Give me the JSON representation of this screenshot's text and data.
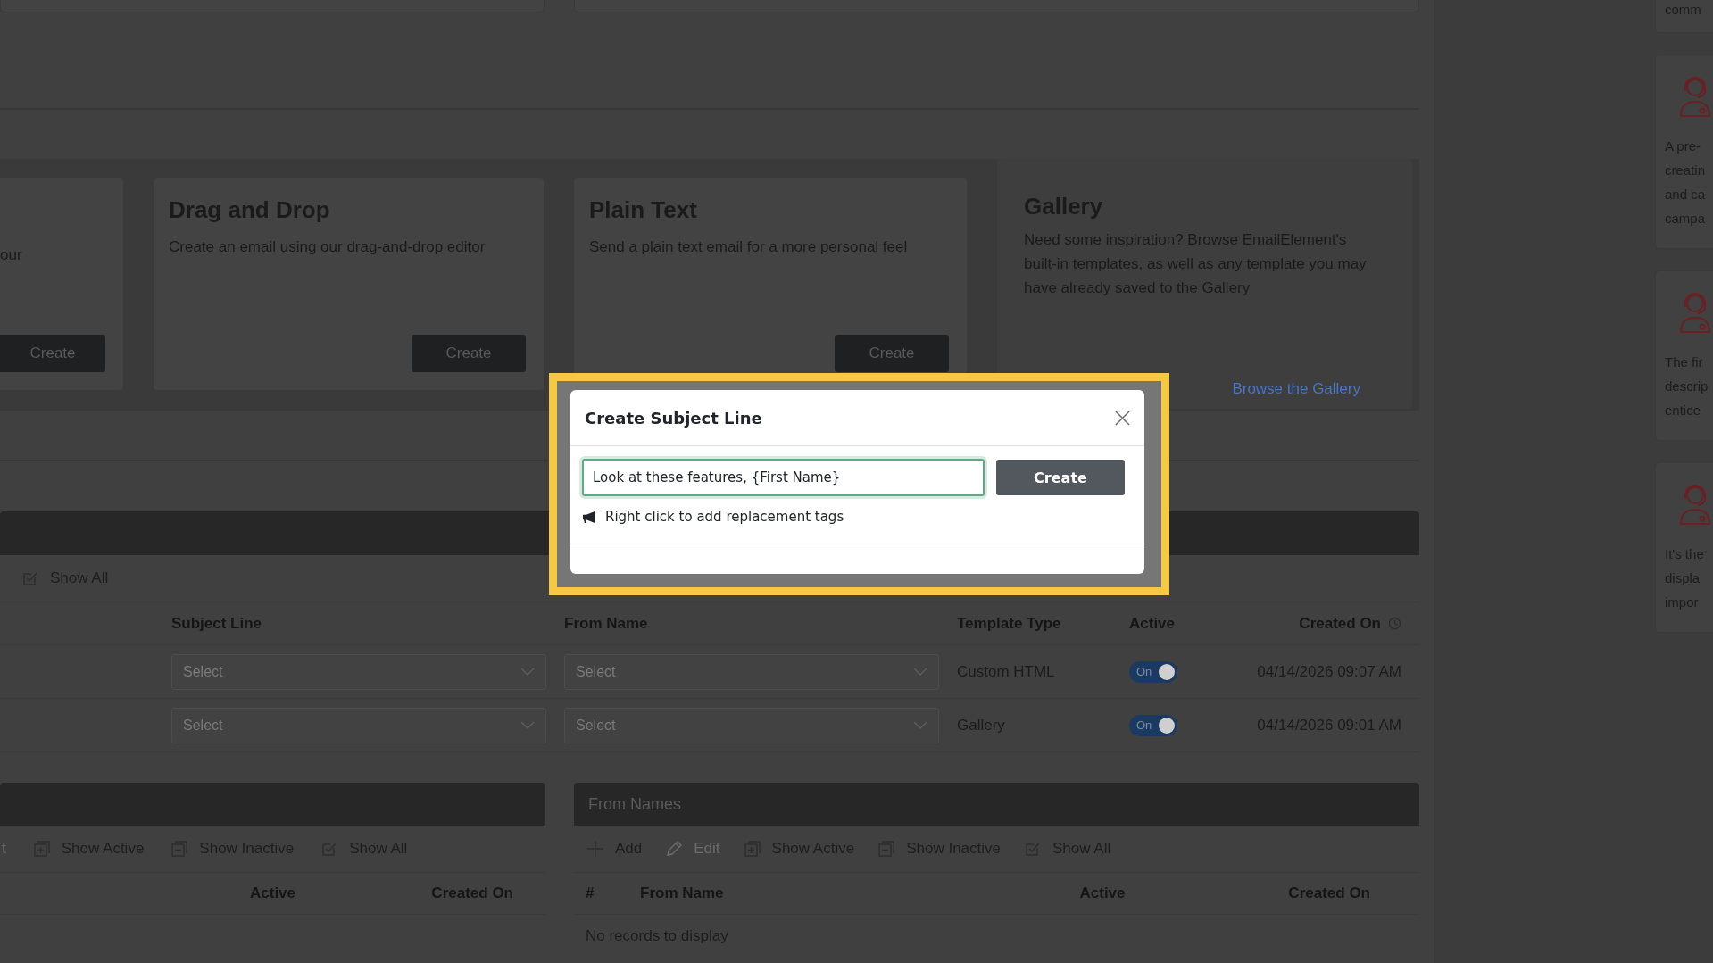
{
  "template_cards": [
    {
      "kind": "button",
      "description": "our",
      "button": "Create"
    },
    {
      "kind": "button",
      "title": "Drag and Drop",
      "description": "Create an email using our drag-and-drop editor",
      "button": "Create"
    },
    {
      "kind": "button",
      "title": "Plain Text",
      "description": "Send a plain text email for a more personal feel",
      "button": "Create"
    },
    {
      "kind": "link",
      "title": "Gallery",
      "description": "Need some inspiration? Browse EmailElement's built-in templates, as well as any template you may have already saved to the Gallery",
      "link": "Browse the Gallery"
    }
  ],
  "subject_lines": {
    "toolbar": [
      {
        "kind": "show_all",
        "label": "Show All",
        "disabled": false
      }
    ],
    "columns": [
      "Subject Line",
      "From Name",
      "Template Type",
      "Active",
      "Created On"
    ],
    "rows": [
      {
        "subject_line": "Select",
        "from_name": "Select",
        "template_type": "Custom HTML",
        "active": {
          "label": "On",
          "on": true
        },
        "created_on": "04/14/2026 09:07 AM"
      },
      {
        "subject_line": "Select",
        "from_name": "Select",
        "template_type": "Gallery",
        "active": {
          "label": "On",
          "on": true
        },
        "created_on": "04/14/2026 09:01 AM"
      }
    ]
  },
  "lists_panel": {
    "toolbar": [
      {
        "kind": "edit_text",
        "label": "t",
        "disabled": true
      },
      {
        "kind": "show_active",
        "label": "Show Active",
        "disabled": false
      },
      {
        "kind": "show_inactive",
        "label": "Show Inactive",
        "disabled": false
      },
      {
        "kind": "show_all",
        "label": "Show All",
        "disabled": false
      }
    ],
    "columns": [
      "Active",
      "Created On"
    ]
  },
  "from_names": {
    "title": "From Names",
    "toolbar": [
      {
        "kind": "add",
        "label": "Add",
        "disabled": false
      },
      {
        "kind": "edit",
        "label": "Edit",
        "disabled": true
      },
      {
        "kind": "show_active",
        "label": "Show Active",
        "disabled": false
      },
      {
        "kind": "show_inactive",
        "label": "Show Inactive",
        "disabled": false
      },
      {
        "kind": "show_all",
        "label": "Show All",
        "disabled": false
      }
    ],
    "columns": [
      "#",
      "From Name",
      "Active",
      "Created On"
    ],
    "empty_message": "No records to display"
  },
  "tips": [
    {
      "avatar": false,
      "lines": [
        "comm"
      ]
    },
    {
      "avatar": true,
      "lines": [
        "A pre-",
        "creatin",
        "and ca",
        "campa"
      ]
    },
    {
      "avatar": true,
      "lines": [
        "The fir",
        "descrip",
        "entice"
      ]
    },
    {
      "avatar": true,
      "lines": [
        "It's the",
        "displa",
        "impor"
      ]
    }
  ],
  "modal": {
    "title": "Create Subject Line",
    "input_value": "Look at these features, {First Name}",
    "button": "Create",
    "hint": "Right click to add replacement tags"
  }
}
